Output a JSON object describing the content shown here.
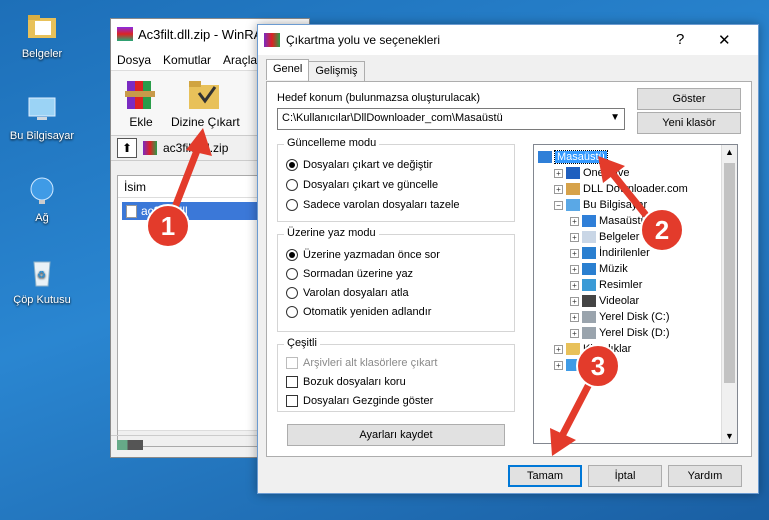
{
  "desktop": {
    "icons": [
      {
        "label": "Belgeler"
      },
      {
        "label": "Bu Bilgisayar"
      },
      {
        "label": "Ağ"
      },
      {
        "label": "Çöp Kutusu"
      }
    ]
  },
  "winrar": {
    "title": "Ac3filt.dll.zip - WinRA",
    "menu": [
      "Dosya",
      "Komutlar",
      "Araçla"
    ],
    "toolbar": {
      "add": "Ekle",
      "extract_to": "Dizine Çıkart"
    },
    "path_label": "ac3filt.dll.zip",
    "column_name": "İsim",
    "file_name": "ac3filt.dll"
  },
  "dialog": {
    "title": "Çıkartma yolu ve seçenekleri",
    "help": "?",
    "close": "✕",
    "tabs": [
      "Genel",
      "Gelişmiş"
    ],
    "dest_label": "Hedef konum (bulunmazsa oluşturulacak)",
    "dest_value": "C:\\Kullanıcılar\\DllDownloader_com\\Masaüstü",
    "show_button": "Göster",
    "new_folder_button": "Yeni klasör",
    "update_mode": {
      "title": "Güncelleme modu",
      "options": [
        "Dosyaları çıkart ve değiştir",
        "Dosyaları çıkart ve güncelle",
        "Sadece varolan dosyaları tazele"
      ],
      "selected": 0
    },
    "overwrite_mode": {
      "title": "Üzerine yaz modu",
      "options": [
        "Üzerine yazmadan önce sor",
        "Sormadan üzerine yaz",
        "Varolan dosyaları atla",
        "Otomatik yeniden adlandır"
      ],
      "selected": 0
    },
    "misc": {
      "title": "Çeşitli",
      "options": [
        {
          "label": "Arşivleri alt klasörlere çıkart",
          "checked": false,
          "disabled": true
        },
        {
          "label": "Bozuk dosyaları koru",
          "checked": false,
          "disabled": false
        },
        {
          "label": "Dosyaları Gezginde göster",
          "checked": false,
          "disabled": false
        }
      ]
    },
    "save_settings_button": "Ayarları kaydet",
    "tree": [
      {
        "label": "Masaüstü",
        "level": 0,
        "selected": true,
        "icon": "desktop-icon"
      },
      {
        "label": "OneDrive",
        "level": 1,
        "icon": "cloud-icon"
      },
      {
        "label": "DLL Downloader.com",
        "level": 1,
        "icon": "user-icon"
      },
      {
        "label": "Bu Bilgisayar",
        "level": 1,
        "icon": "computer-icon"
      },
      {
        "label": "Masaüstü",
        "level": 2,
        "icon": "desktop-icon"
      },
      {
        "label": "Belgeler",
        "level": 2,
        "icon": "documents-icon"
      },
      {
        "label": "İndirilenler",
        "level": 2,
        "icon": "download-icon"
      },
      {
        "label": "Müzik",
        "level": 2,
        "icon": "music-icon"
      },
      {
        "label": "Resimler",
        "level": 2,
        "icon": "pictures-icon"
      },
      {
        "label": "Videolar",
        "level": 2,
        "icon": "videos-icon"
      },
      {
        "label": "Yerel Disk (C:)",
        "level": 2,
        "icon": "drive-icon"
      },
      {
        "label": "Yerel Disk (D:)",
        "level": 2,
        "icon": "drive-icon"
      },
      {
        "label": "Kitaplıklar",
        "level": 1,
        "icon": "folder-icon"
      },
      {
        "label": "Ağ",
        "level": 1,
        "icon": "network-icon"
      }
    ],
    "ok_button": "Tamam",
    "cancel_button": "İptal",
    "help_button": "Yardım"
  },
  "annotations": {
    "markers": [
      "1",
      "2",
      "3"
    ],
    "color": "#e33b2b"
  }
}
